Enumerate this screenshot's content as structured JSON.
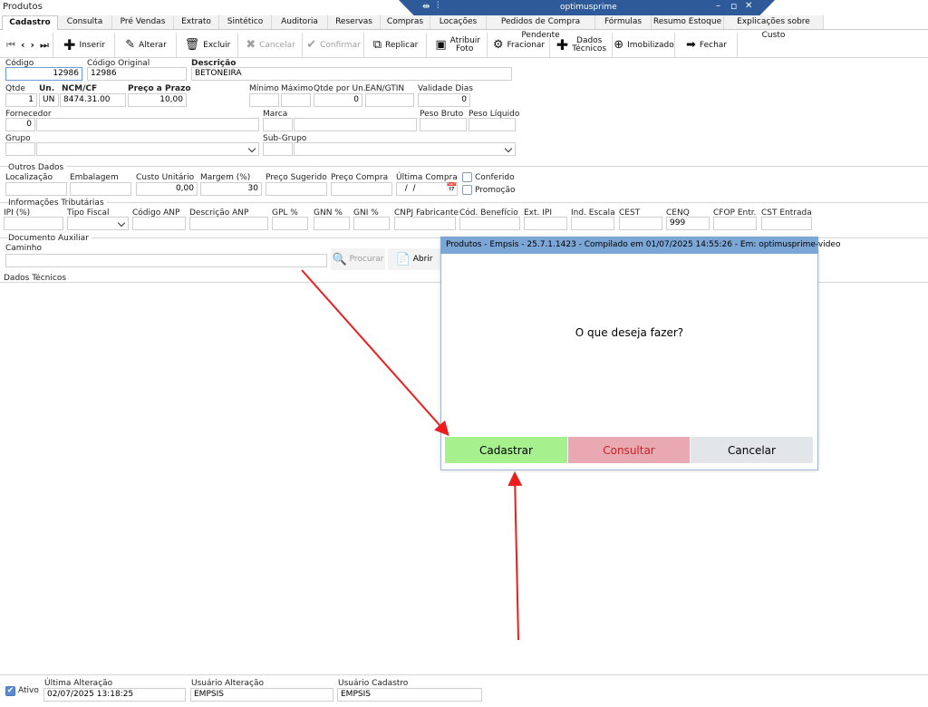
{
  "window": {
    "title": "Produtos",
    "remote_title": "optimusprime",
    "remote_controls": [
      "–",
      "▫",
      "✕"
    ]
  },
  "tabs": [
    {
      "label": "Cadastro",
      "active": true
    },
    {
      "label": "Consulta"
    },
    {
      "label": "Pré Vendas"
    },
    {
      "label": "Extrato"
    },
    {
      "label": "Sintético"
    },
    {
      "label": "Auditoria"
    },
    {
      "label": "Reservas"
    },
    {
      "label": "Compras"
    },
    {
      "label": "Locações"
    },
    {
      "label": "Pedidos de Compra Pendente"
    },
    {
      "label": "Fórmulas"
    },
    {
      "label": "Resumo Estoque"
    },
    {
      "label": "Explicações sobre Custo"
    }
  ],
  "toolbar": {
    "nav": [
      "⏮",
      "‹",
      "›",
      "⏭"
    ],
    "inserir": "Inserir",
    "alterar": "Alterar",
    "excluir": "Excluir",
    "cancelar": "Cancelar",
    "confirmar": "Confirmar",
    "replicar": "Replicar",
    "atribuir_foto": "Atribuir Foto",
    "fracionar": "Fracionar",
    "dados_tecnicos": "Dados Técnicos",
    "imobilizado": "Imobilizado",
    "fechar": "Fechar"
  },
  "form": {
    "codigo_label": "Código",
    "codigo": "12986",
    "codigo_original_label": "Código Original",
    "codigo_original": "12986",
    "descricao_label": "Descrição",
    "descricao": "BETONEIRA",
    "qtde_label": "Qtde",
    "qtde": "1",
    "un_label": "Un.",
    "un": "UN",
    "ncm_label": "NCM/CF",
    "ncm": "8474.31.00",
    "preco_prazo_label": "Preço a Prazo",
    "preco_prazo": "10,00",
    "minimo_label": "Mínimo",
    "maximo_label": "Máximo",
    "qtde_por_un_label": "Qtde por Un.",
    "qtde_por_un": "0",
    "ean_label": "EAN/GTIN",
    "validade_label": "Validade Dias",
    "validade": "0",
    "fornecedor_label": "Fornecedor",
    "fornecedor": "0",
    "marca_label": "Marca",
    "peso_bruto_label": "Peso Bruto",
    "peso_liquido_label": "Peso Líquido",
    "grupo_label": "Grupo",
    "subgrupo_label": "Sub-Grupo"
  },
  "outros": {
    "title": "Outros Dados",
    "localizacao_label": "Localização",
    "embalagem_label": "Embalagem",
    "custo_label": "Custo Unitário",
    "custo": "0,00",
    "margem_label": "Margem (%)",
    "margem": "30",
    "preco_sugerido_label": "Preço Sugerido",
    "preco_compra_label": "Preço Compra",
    "ultima_compra_label": "Última Compra",
    "ultima_compra": "  /  /",
    "conferido_label": "Conferido",
    "promocao_label": "Promoção"
  },
  "tributarias": {
    "title": "Informações Tributárias",
    "cols": [
      "IPI (%)",
      "Tipo Fiscal",
      "Código ANP",
      "Descrição ANP",
      "GPL %",
      "GNN %",
      "GNI %",
      "CNPJ Fabricante",
      "Cód. Benefício",
      "Ext. IPI",
      "Ind. Escala",
      "CEST",
      "CENQ",
      "CFOP Entr.",
      "CST Entrada"
    ],
    "cenq": "999"
  },
  "documento": {
    "title": "Documento Auxiliar",
    "caminho_label": "Caminho",
    "procurar": "Procurar",
    "abrir": "Abrir"
  },
  "dados_tecnicos_label": "Dados Técnicos",
  "footer": {
    "ativo_label": "Ativo",
    "ultima_alteracao_label": "Última Alteração",
    "ultima_alteracao": "02/07/2025 13:18:25",
    "usuario_alteracao_label": "Usuário Alteração",
    "usuario_alteracao": "EMPSIS",
    "usuario_cadastro_label": "Usuário Cadastro",
    "usuario_cadastro": "EMPSIS"
  },
  "dialog": {
    "title": "Produtos - Empsis - 25.7.1.1423 - Compilado em 01/07/2025 14:55:26 - Em: optimusprime-video",
    "message": "O que deseja fazer?",
    "cadastrar": "Cadastrar",
    "consultar": "Consultar",
    "cancelar": "Cancelar"
  },
  "colors": {
    "dialog_title_bg": "#7ba6d6",
    "cadastrar_bg": "#a6f08e",
    "consultar_bg": "#e8a9b3",
    "cancelar_bg": "#e3e6e8",
    "arrow": "#ee1c1c",
    "remote_bar": "#2f5a99"
  }
}
